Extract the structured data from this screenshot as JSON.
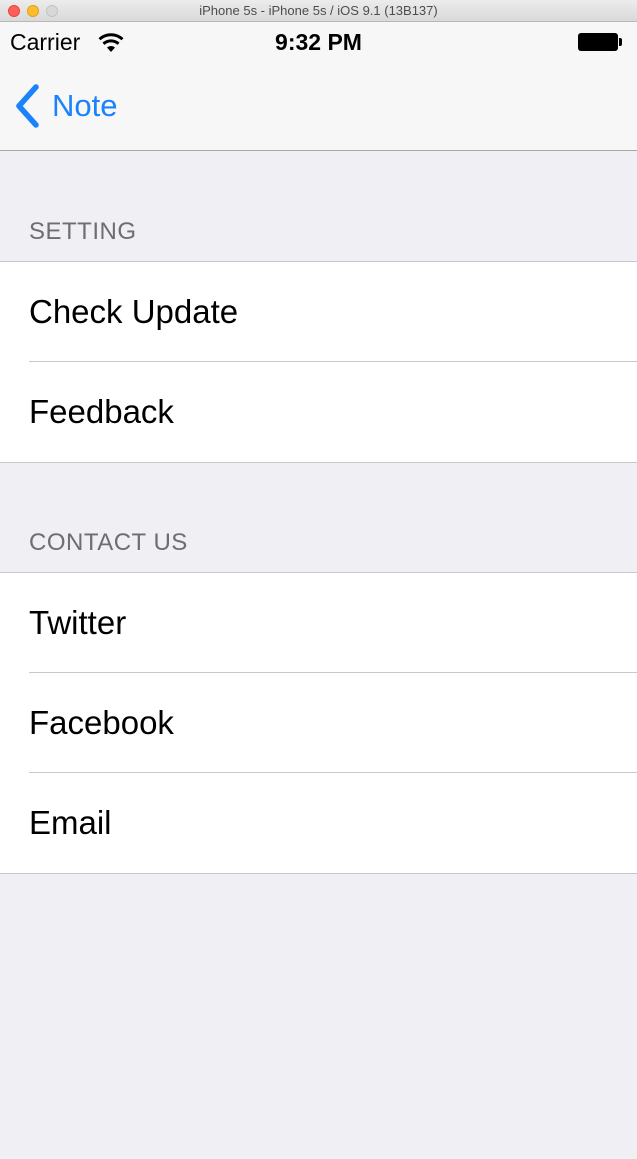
{
  "window": {
    "title": "iPhone 5s - iPhone 5s / iOS 9.1 (13B137)"
  },
  "status_bar": {
    "carrier": "Carrier",
    "time": "9:32 PM",
    "wifi_icon": "wifi-icon",
    "battery_icon": "battery-icon",
    "battery_level": 1.0
  },
  "nav_bar": {
    "back_label": "Note",
    "back_icon": "chevron-left-icon",
    "accent_color": "#1a82fb"
  },
  "sections": [
    {
      "header": "SETTING",
      "items": [
        {
          "label": "Check Update"
        },
        {
          "label": "Feedback"
        }
      ]
    },
    {
      "header": "CONTACT US",
      "items": [
        {
          "label": "Twitter"
        },
        {
          "label": "Facebook"
        },
        {
          "label": "Email"
        }
      ]
    }
  ],
  "colors": {
    "background": "#efeff4",
    "separator": "#c8c7cc",
    "section_header_text": "#6d6d72"
  }
}
